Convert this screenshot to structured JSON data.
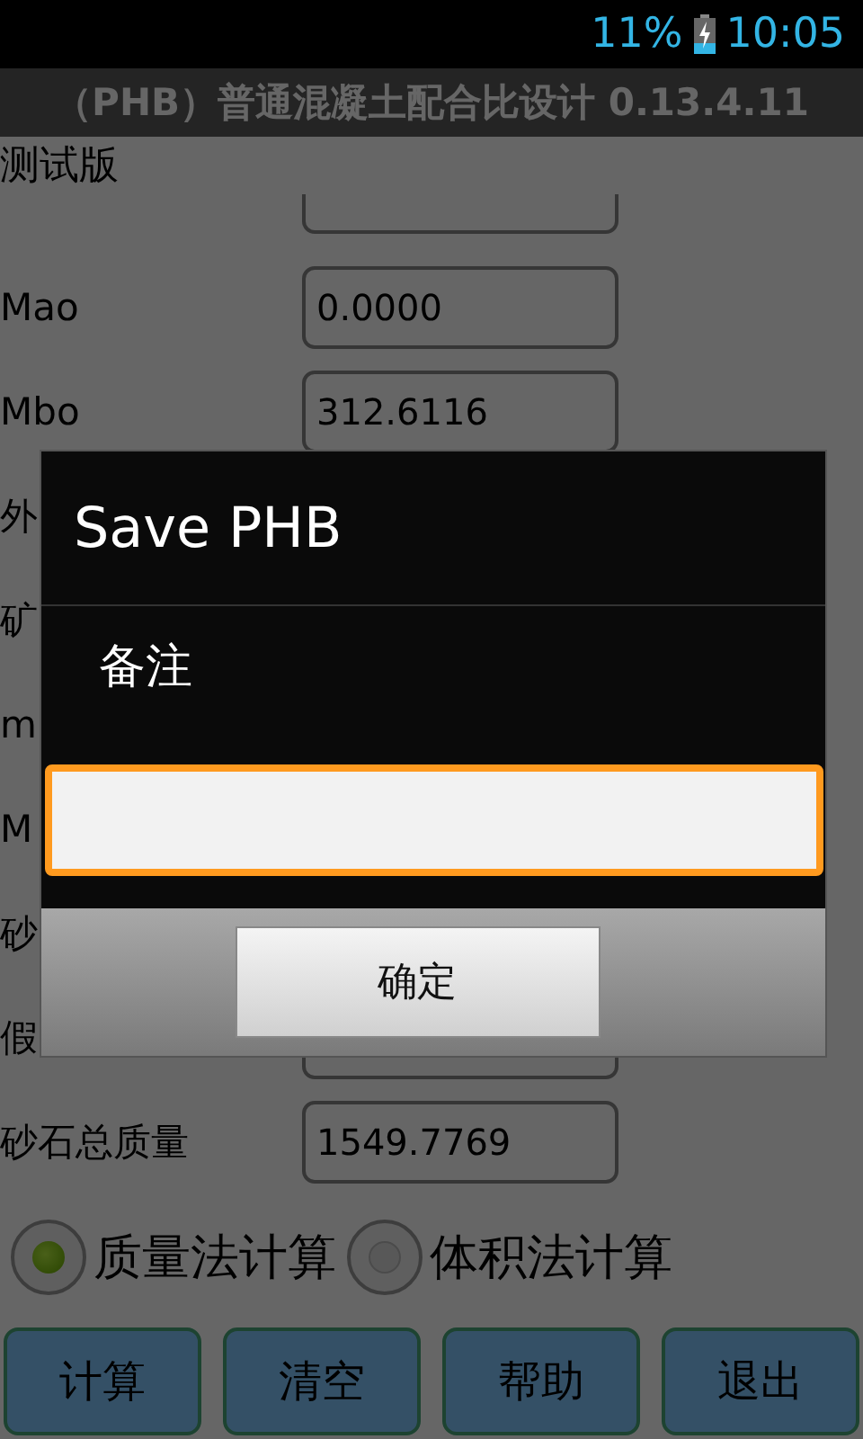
{
  "status_bar": {
    "battery": "11%",
    "time": "10:05"
  },
  "title": "（PHB）普通混凝土配合比设计 0.13.4.11",
  "subtitle": "测试版",
  "form_rows": [
    {
      "label": "Mao",
      "value": "0.0000"
    },
    {
      "label": "Mbo",
      "value": "312.6116"
    },
    {
      "label": "外"
    },
    {
      "label": "矿"
    },
    {
      "label": "m"
    },
    {
      "label": "M"
    },
    {
      "label": "砂"
    },
    {
      "label": "假",
      "has_field": true
    },
    {
      "label": "砂石总质量",
      "value": "1549.7769"
    }
  ],
  "radios": [
    {
      "label": "质量法计算",
      "selected": true
    },
    {
      "label": "体积法计算",
      "selected": false
    }
  ],
  "buttons": [
    "计算",
    "清空",
    "帮助",
    "退出"
  ],
  "dialog": {
    "title": "Save PHB",
    "message": "备注",
    "input": {
      "focused": true
    },
    "button": "确定"
  }
}
